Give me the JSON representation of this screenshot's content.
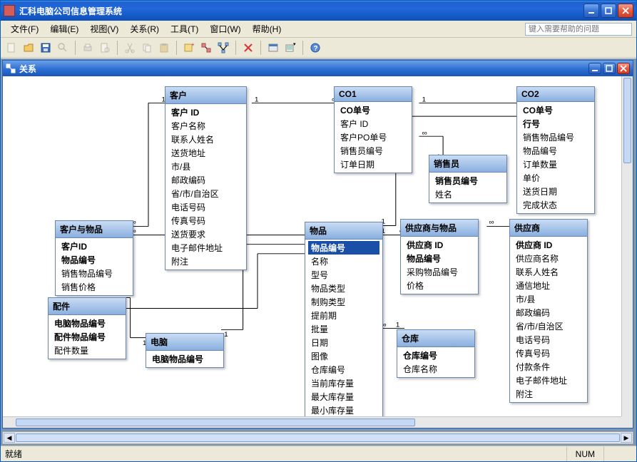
{
  "app_title": "汇科电脑公司信息管理系统",
  "menu": {
    "file": "文件(F)",
    "edit": "编辑(E)",
    "view": "视图(V)",
    "relation": "关系(R)",
    "tool": "工具(T)",
    "window": "窗口(W)",
    "help": "帮助(H)"
  },
  "help_placeholder": "键入需要帮助的问题",
  "child_title": "关系",
  "status_ready": "就绪",
  "status_num": "NUM",
  "entities": {
    "customer": {
      "title": "客户",
      "fields": [
        "客户 ID",
        "客户名称",
        "联系人姓名",
        "送货地址",
        "市/县",
        "邮政编码",
        "省/市/自治区",
        "电话号码",
        "传真号码",
        "送货要求",
        "电子邮件地址",
        "附注"
      ]
    },
    "customer_item": {
      "title": "客户与物品",
      "fields": [
        "客户ID",
        "物品编号",
        "销售物品编号",
        "销售价格"
      ]
    },
    "part": {
      "title": "配件",
      "fields": [
        "电脑物品编号",
        "配件物品编号",
        "配件数量"
      ]
    },
    "computer": {
      "title": "电脑",
      "fields": [
        "电脑物品编号"
      ]
    },
    "co1": {
      "title": "CO1",
      "fields": [
        "CO单号",
        "客户 ID",
        "客户PO单号",
        "销售员编号",
        "订单日期"
      ]
    },
    "salesman": {
      "title": "销售员",
      "fields": [
        "销售员编号",
        "姓名"
      ]
    },
    "item": {
      "title": "物品",
      "fields": [
        "物品编号",
        "名称",
        "型号",
        "物品类型",
        "制购类型",
        "提前期",
        "批量",
        "日期",
        "图像",
        "仓库编号",
        "当前库存量",
        "最大库存量",
        "最小库存量"
      ]
    },
    "supplier_item": {
      "title": "供应商与物品",
      "fields": [
        "供应商 ID",
        "物品编号",
        "采购物品编号",
        "价格"
      ]
    },
    "warehouse": {
      "title": "仓库",
      "fields": [
        "仓库编号",
        "仓库名称"
      ]
    },
    "co2": {
      "title": "CO2",
      "fields": [
        "CO单号",
        "行号",
        "销售物品编号",
        "物品编号",
        "订单数量",
        "单价",
        "送货日期",
        "完成状态"
      ]
    },
    "supplier": {
      "title": "供应商",
      "fields": [
        "供应商 ID",
        "供应商名称",
        "联系人姓名",
        "通信地址",
        "市/县",
        "邮政编码",
        "省/市/自治区",
        "电话号码",
        "传真号码",
        "付款条件",
        "电子邮件地址",
        "附注"
      ]
    }
  },
  "chart_data": {
    "type": "table",
    "description": "Microsoft Access relationship diagram",
    "tables": [
      {
        "name": "客户",
        "pk": [
          "客户 ID"
        ],
        "fields": [
          "客户 ID",
          "客户名称",
          "联系人姓名",
          "送货地址",
          "市/县",
          "邮政编码",
          "省/市/自治区",
          "电话号码",
          "传真号码",
          "送货要求",
          "电子邮件地址",
          "附注"
        ]
      },
      {
        "name": "客户与物品",
        "pk": [
          "客户ID",
          "物品编号"
        ],
        "fields": [
          "客户ID",
          "物品编号",
          "销售物品编号",
          "销售价格"
        ]
      },
      {
        "name": "配件",
        "pk": [
          "电脑物品编号",
          "配件物品编号"
        ],
        "fields": [
          "电脑物品编号",
          "配件物品编号",
          "配件数量"
        ]
      },
      {
        "name": "电脑",
        "pk": [
          "电脑物品编号"
        ],
        "fields": [
          "电脑物品编号"
        ]
      },
      {
        "name": "CO1",
        "pk": [
          "CO单号"
        ],
        "fields": [
          "CO单号",
          "客户 ID",
          "客户PO单号",
          "销售员编号",
          "订单日期"
        ]
      },
      {
        "name": "销售员",
        "pk": [
          "销售员编号"
        ],
        "fields": [
          "销售员编号",
          "姓名"
        ]
      },
      {
        "name": "物品",
        "pk": [
          "物品编号"
        ],
        "fields": [
          "物品编号",
          "名称",
          "型号",
          "物品类型",
          "制购类型",
          "提前期",
          "批量",
          "日期",
          "图像",
          "仓库编号",
          "当前库存量",
          "最大库存量",
          "最小库存量"
        ]
      },
      {
        "name": "供应商与物品",
        "pk": [
          "供应商 ID",
          "物品编号"
        ],
        "fields": [
          "供应商 ID",
          "物品编号",
          "采购物品编号",
          "价格"
        ]
      },
      {
        "name": "仓库",
        "pk": [
          "仓库编号"
        ],
        "fields": [
          "仓库编号",
          "仓库名称"
        ]
      },
      {
        "name": "CO2",
        "pk": [
          "CO单号",
          "行号"
        ],
        "fields": [
          "CO单号",
          "行号",
          "销售物品编号",
          "物品编号",
          "订单数量",
          "单价",
          "送货日期",
          "完成状态"
        ]
      },
      {
        "name": "供应商",
        "pk": [
          "供应商 ID"
        ],
        "fields": [
          "供应商 ID",
          "供应商名称",
          "联系人姓名",
          "通信地址",
          "市/县",
          "邮政编码",
          "省/市/自治区",
          "电话号码",
          "传真号码",
          "付款条件",
          "电子邮件地址",
          "附注"
        ]
      }
    ],
    "relationships": [
      {
        "from": "客户.客户 ID",
        "to": "客户与物品.客户ID",
        "type": "1-∞"
      },
      {
        "from": "客户.客户 ID",
        "to": "CO1.客户 ID",
        "type": "1-∞"
      },
      {
        "from": "CO1.CO单号",
        "to": "CO2.CO单号",
        "type": "1-∞"
      },
      {
        "from": "CO1.销售员编号",
        "to": "销售员.销售员编号",
        "type": "∞-1"
      },
      {
        "from": "物品.物品编号",
        "to": "客户与物品.物品编号",
        "type": "1-∞"
      },
      {
        "from": "物品.物品编号",
        "to": "电脑.电脑物品编号",
        "type": "1-1"
      },
      {
        "from": "物品.物品编号",
        "to": "配件.配件物品编号",
        "type": "1-∞"
      },
      {
        "from": "电脑.电脑物品编号",
        "to": "配件.电脑物品编号",
        "type": "1-∞"
      },
      {
        "from": "物品.物品编号",
        "to": "供应商与物品.物品编号",
        "type": "1-∞"
      },
      {
        "from": "物品.仓库编号",
        "to": "仓库.仓库编号",
        "type": "∞-1"
      },
      {
        "from": "物品.物品编号",
        "to": "CO2.物品编号",
        "type": "1-∞"
      },
      {
        "from": "供应商.供应商 ID",
        "to": "供应商与物品.供应商 ID",
        "type": "1-∞"
      }
    ]
  }
}
